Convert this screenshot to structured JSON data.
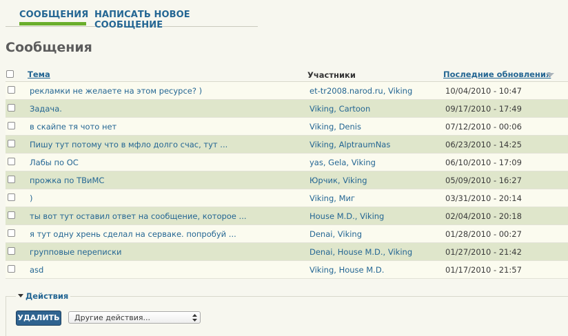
{
  "tabs": {
    "messages": "СООБЩЕНИЯ",
    "compose": "НАПИСАТЬ НОВОЕ СООБЩЕНИЕ"
  },
  "page_title": "Сообщения",
  "table": {
    "headers": {
      "subject": "Тема",
      "participants": "Участники",
      "last_updated": "Последние обновления"
    },
    "rows": [
      {
        "subject": "рекламки не желаете на этом ресурсе? )",
        "participants": "et-tr2008.narod.ru, Viking",
        "date": "10/04/2010 - 10:47"
      },
      {
        "subject": "Задача.",
        "participants": "Viking, Cartoon",
        "date": "09/17/2010 - 17:49"
      },
      {
        "subject": "в скайпе тя чото нет",
        "participants": "Viking, Denis",
        "date": "07/12/2010 - 00:06"
      },
      {
        "subject": "Пишу тут потому что в мфло долго счас, тут ...",
        "participants": "Viking, AlptraumNas",
        "date": "06/23/2010 - 14:25"
      },
      {
        "subject": "Лабы по ОС",
        "participants": "yas, Gela, Viking",
        "date": "06/10/2010 - 17:09"
      },
      {
        "subject": "прожка по ТВиМС",
        "participants": "Юрчик, Viking",
        "date": "05/09/2010 - 16:27"
      },
      {
        "subject": ")",
        "participants": "Viking, Миг",
        "date": "03/31/2010 - 20:14"
      },
      {
        "subject": "ты вот тут оставил ответ на сообщение, которое ...",
        "participants": "House M.D., Viking",
        "date": "02/04/2010 - 20:18"
      },
      {
        "subject": "я тут одну хрень сделал на серваке. попробуй ...",
        "participants": "Denai, Viking",
        "date": "01/28/2010 - 00:27"
      },
      {
        "subject": "групповые переписки",
        "participants": "Denai, House M.D., Viking",
        "date": "01/27/2010 - 21:42"
      },
      {
        "subject": "asd",
        "participants": "Viking, House M.D.",
        "date": "01/17/2010 - 21:57"
      }
    ]
  },
  "actions": {
    "legend": "Действия",
    "delete_label": "УДАЛИТЬ",
    "other_actions": "Другие действия..."
  }
}
